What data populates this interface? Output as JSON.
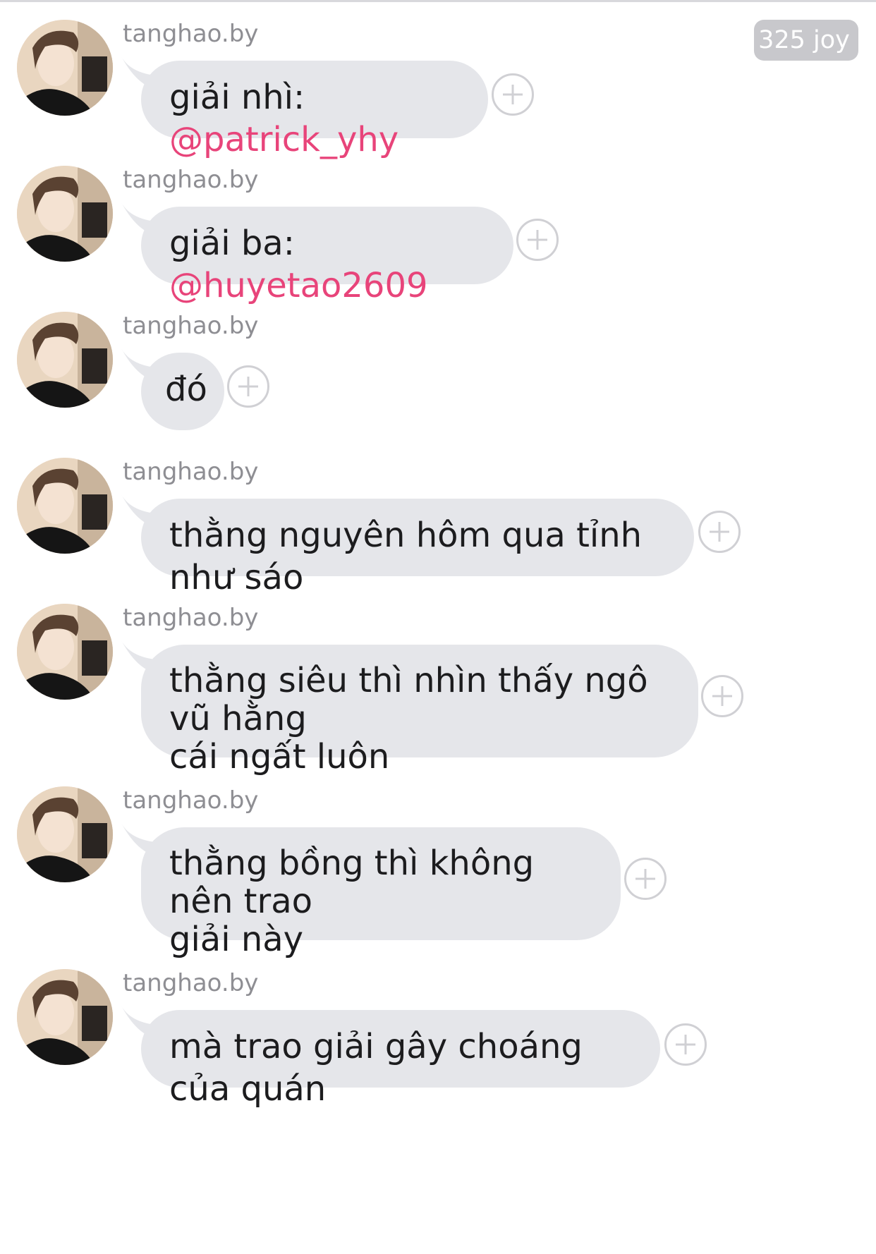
{
  "header": {
    "joy_badge": "325 joy"
  },
  "messages": [
    {
      "username": "tanghao.by",
      "text": "giải nhì: ",
      "mention": "@patrick_yhy"
    },
    {
      "username": "tanghao.by",
      "text": "giải ba: ",
      "mention": "@huyetao2609"
    },
    {
      "username": "tanghao.by",
      "text": "đó",
      "mention": ""
    },
    {
      "username": "tanghao.by",
      "text": "thằng nguyên hôm qua tỉnh như sáo",
      "mention": ""
    },
    {
      "username": "tanghao.by",
      "line1": "thằng siêu thì nhìn thấy ngô vũ hằng",
      "line2": "cái ngất luôn"
    },
    {
      "username": "tanghao.by",
      "line1": "thằng bồng thì không nên trao",
      "line2": "giải này"
    },
    {
      "username": "tanghao.by",
      "text": "mà trao giải gây choáng của quán",
      "mention": ""
    }
  ],
  "colors": {
    "bubble": "#e5e6ea",
    "mention": "#e8447a",
    "username": "#8e8e93",
    "badge": "#c8c8cc"
  },
  "icons": {
    "add_reaction": "plus-circle-icon",
    "avatar": "user-avatar"
  }
}
